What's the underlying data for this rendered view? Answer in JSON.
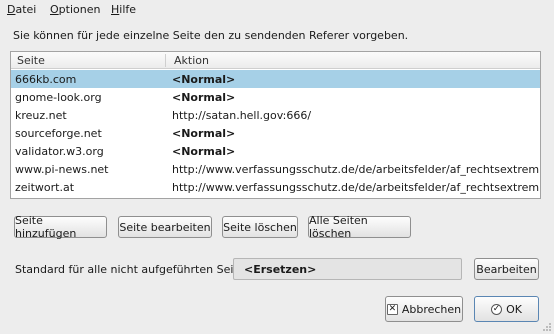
{
  "menu": [
    {
      "label_u": "D",
      "label_rest": "atei"
    },
    {
      "label_u": "O",
      "label_rest": "ptionen"
    },
    {
      "label_u": "H",
      "label_rest": "ilfe"
    }
  ],
  "intro_text": "Sie können für jede einzelne Seite den zu sendenden Referer vorgeben.",
  "table": {
    "headers": [
      "Seite",
      "Aktion"
    ],
    "rows": [
      {
        "site": "666kb.com",
        "action": "<Normal>",
        "bold": true,
        "selected": true
      },
      {
        "site": "gnome-look.org",
        "action": "<Normal>",
        "bold": true,
        "selected": false
      },
      {
        "site": "kreuz.net",
        "action": "http://satan.hell.gov:666/",
        "bold": false,
        "selected": false
      },
      {
        "site": "sourceforge.net",
        "action": "<Normal>",
        "bold": true,
        "selected": false
      },
      {
        "site": "validator.w3.org",
        "action": "<Normal>",
        "bold": true,
        "selected": false
      },
      {
        "site": "www.pi-news.net",
        "action": "http://www.verfassungsschutz.de/de/arbeitsfelder/af_rechtsextremismus/",
        "bold": false,
        "selected": false
      },
      {
        "site": "zeitwort.at",
        "action": "http://www.verfassungsschutz.de/de/arbeitsfelder/af_rechtsextremismus/",
        "bold": false,
        "selected": false
      }
    ]
  },
  "buttons": {
    "add": "Seite hinzufügen",
    "edit": "Seite bearbeiten",
    "delete": "Seite löschen",
    "delete_all": "Alle Seiten löschen"
  },
  "standard": {
    "label": "Standard für alle nicht aufgeführten Seiten:",
    "value": "<Ersetzen>",
    "edit_button": "Bearbeiten"
  },
  "dialog": {
    "cancel": "Abbrechen",
    "ok": "OK"
  },
  "icons": {
    "cancel": "close-icon",
    "ok": "checkmark-icon"
  },
  "colors": {
    "selection": "#a6d0e7",
    "background": "#ededed"
  }
}
